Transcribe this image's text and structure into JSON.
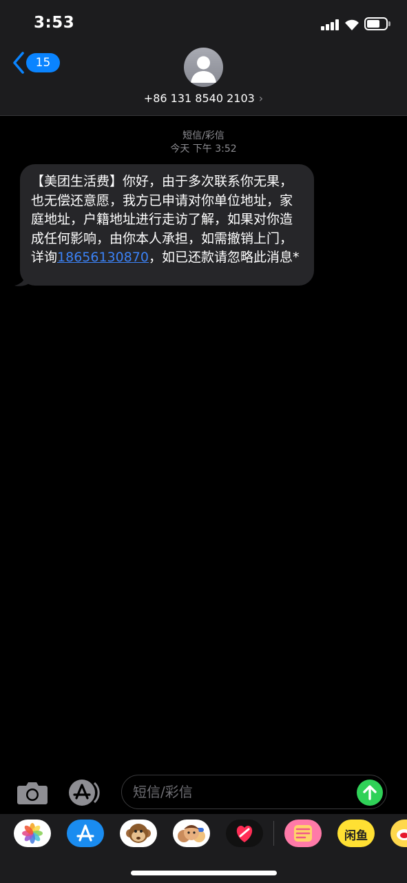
{
  "status_bar": {
    "time": "3:53"
  },
  "header": {
    "back_badge": "15",
    "contact": "+86 131 8540 2103",
    "chevron": "›"
  },
  "conversation": {
    "service_label": "短信/彩信",
    "timestamp": "今天 下午 3:52",
    "message": {
      "text_before": "【美团生活费】你好，由于多次联系你无果，也无偿还意愿，我方已申请对你单位地址，家庭地址，户籍地址进行走访了解，如果对你造成任何影响，由你本人承担，如需撤销上门，详询",
      "link": "18656130870",
      "text_after": "，如已还款请忽略此消息*"
    }
  },
  "input_bar": {
    "placeholder": "短信/彩信"
  },
  "app_drawer": {
    "apps": [
      {
        "name": "photos-icon"
      },
      {
        "name": "app-store-icon"
      },
      {
        "name": "monkey-animoji-icon"
      },
      {
        "name": "memoji-icon"
      },
      {
        "name": "digital-touch-icon"
      },
      {
        "name": "sticker-app-icon"
      },
      {
        "name": "xianyu-app-icon",
        "label": "闲鱼"
      },
      {
        "name": "weibo-app-icon"
      }
    ]
  },
  "colors": {
    "accent": "#0a84ff",
    "link": "#3b82f6",
    "send": "#30d158",
    "bubble": "#262629",
    "header_bg": "#1c1c1e"
  }
}
